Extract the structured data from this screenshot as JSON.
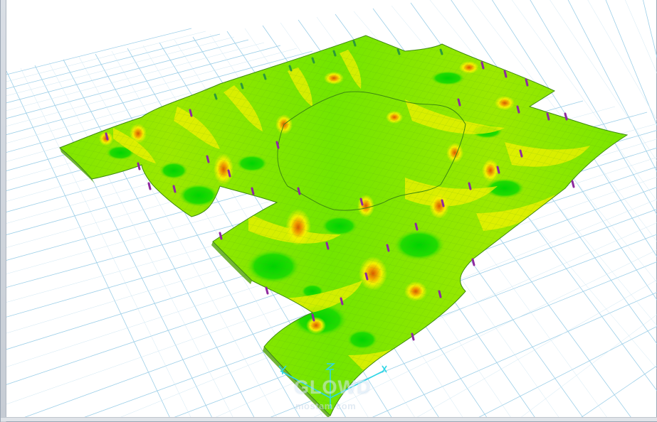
{
  "window": {
    "view": "3d-model-viewport",
    "grid_visible": true
  },
  "model": {
    "type": "deformed-slab-contour-plot",
    "contour_colors": [
      "#00d400",
      "#7be800",
      "#f2f200",
      "#f0a000",
      "#d85a00"
    ],
    "grid_line_color": "#9ccfe8",
    "mesh_line_color": "#4f9a1c",
    "support_colors": [
      "#8e2a9e",
      "#2e9a3a",
      "#d63aa0"
    ],
    "axis_icon": "xyz-axis-triad-icon"
  },
  "watermark": {
    "brand": "GLOWD",
    "site": "mostam.com"
  }
}
